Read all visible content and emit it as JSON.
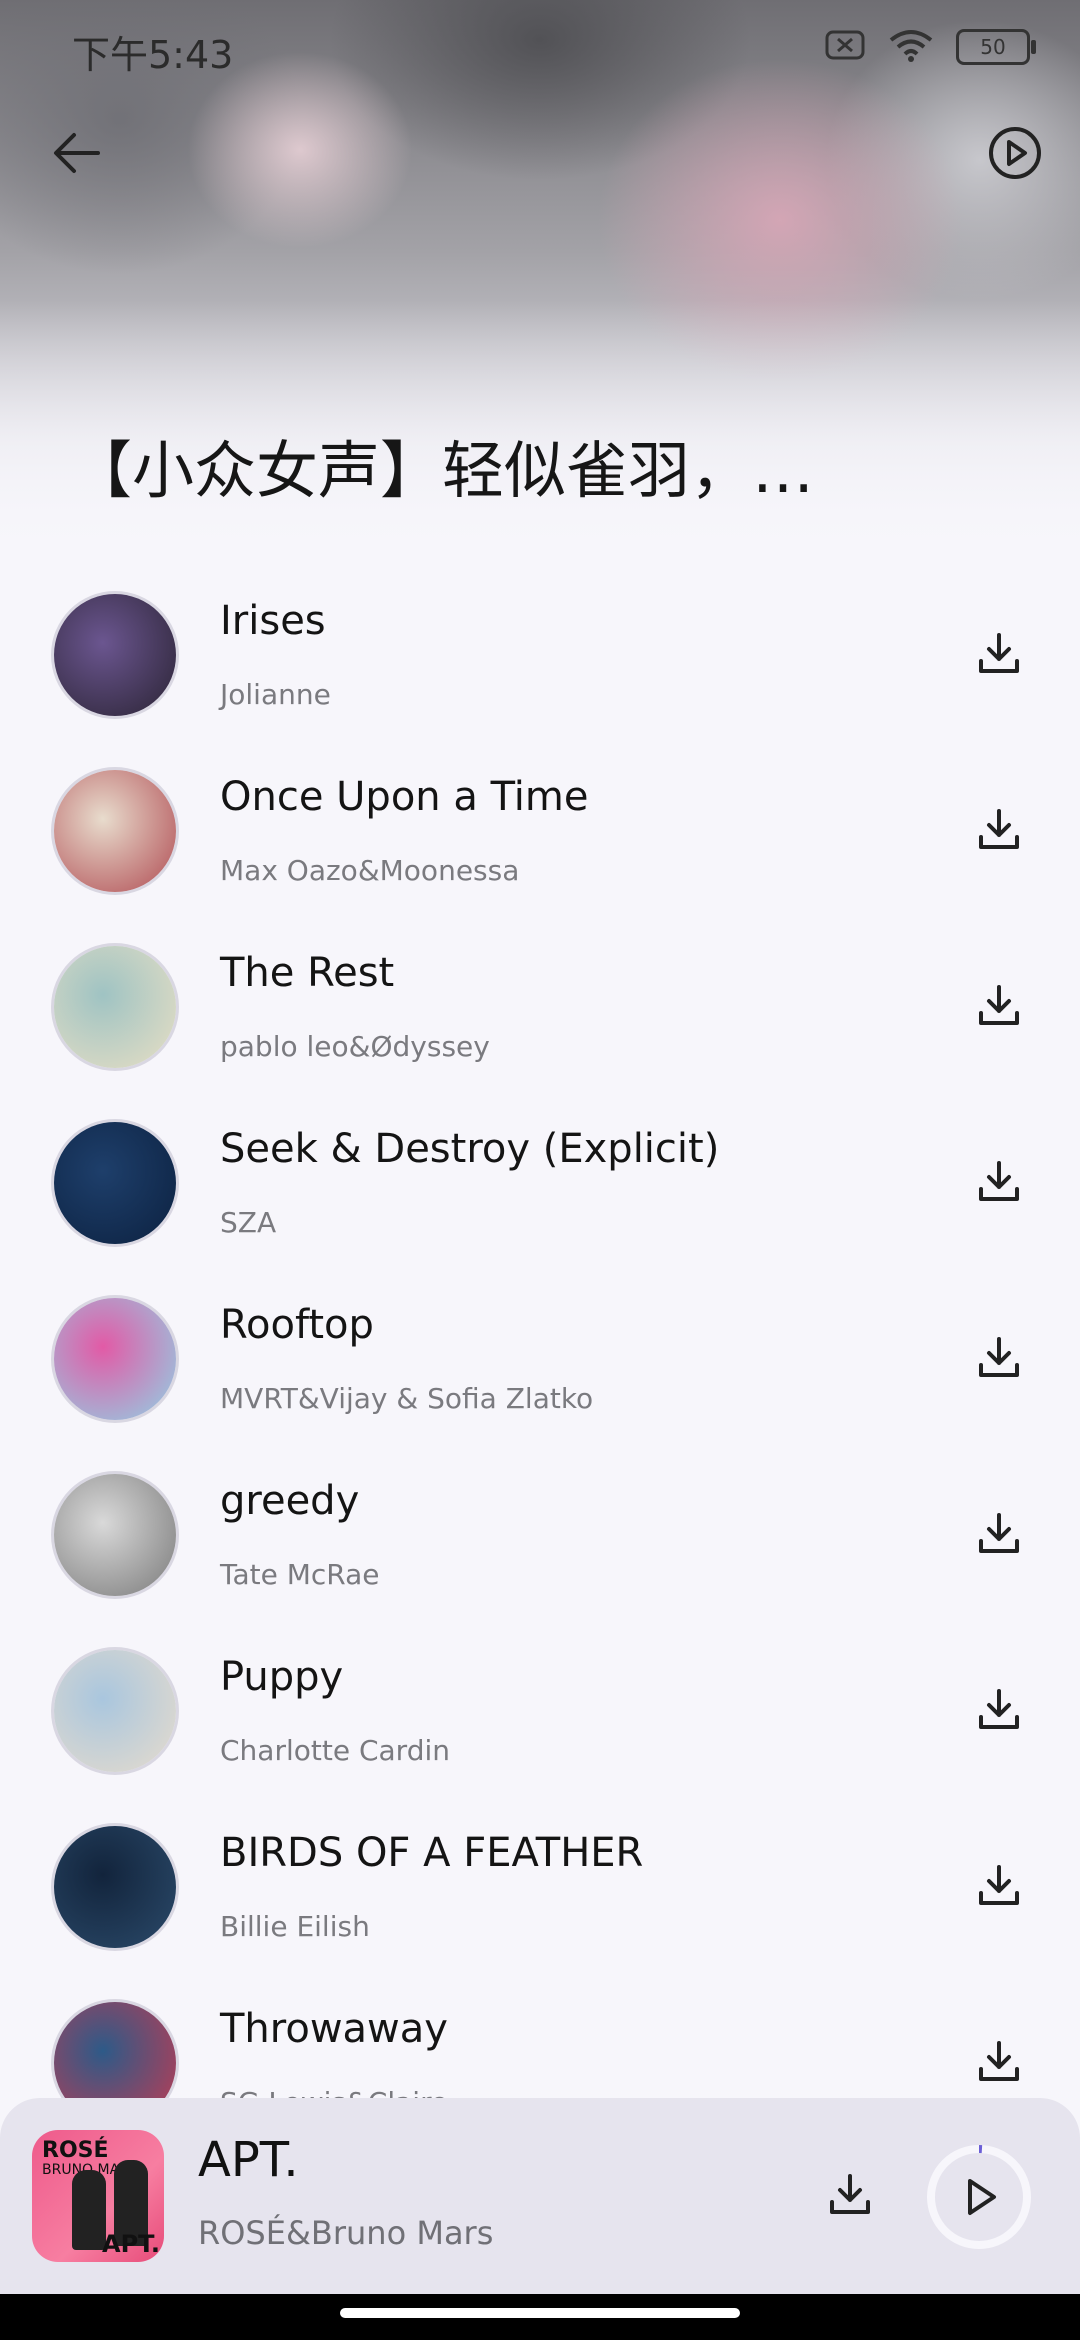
{
  "status_bar": {
    "time": "下午5:43",
    "battery": "50"
  },
  "header": {
    "playlist_title": "【小众女声】轻似雀羽，…"
  },
  "songs": [
    {
      "title": "Irises",
      "artist": "Jolianne",
      "cover_colors": [
        "#6b5690",
        "#2a2333"
      ]
    },
    {
      "title": "Once Upon a Time",
      "artist": "Max Oazo&Moonessa",
      "cover_colors": [
        "#e8dccd",
        "#b04b52"
      ]
    },
    {
      "title": "The Rest",
      "artist": "pablo leo&Ødyssey",
      "cover_colors": [
        "#9fc3c3",
        "#e8dfc4"
      ]
    },
    {
      "title": "Seek & Destroy (Explicit)",
      "artist": "SZA",
      "cover_colors": [
        "#1e3f6b",
        "#0c2140"
      ]
    },
    {
      "title": "Rooftop",
      "artist": "MVRT&Vijay & Sofia Zlatko",
      "cover_colors": [
        "#e25aa6",
        "#8fd3e6"
      ]
    },
    {
      "title": "greedy",
      "artist": "Tate McRae",
      "cover_colors": [
        "#d9d9d9",
        "#7a7a7a"
      ]
    },
    {
      "title": "Puppy",
      "artist": "Charlotte Cardin",
      "cover_colors": [
        "#a9c6de",
        "#e7dccd"
      ]
    },
    {
      "title": "BIRDS OF A FEATHER",
      "artist": "Billie Eilish",
      "cover_colors": [
        "#12243c",
        "#2b4a6a"
      ]
    },
    {
      "title": "Throwaway",
      "artist": "SG Lewis&Clairo",
      "cover_colors": [
        "#2d5a88",
        "#c23b52"
      ]
    }
  ],
  "now_playing": {
    "title": "APT.",
    "artist": "ROSÉ&Bruno Mars",
    "cover_text_1": "ROSÉ",
    "cover_text_2": "BRUNO MARS",
    "cover_text_3": "APT.",
    "progress": 0.01
  },
  "colors": {
    "background": "#f7f6fb",
    "mini_player_bg": "#e6e4ee",
    "secondary_text": "#7a7a7f"
  }
}
